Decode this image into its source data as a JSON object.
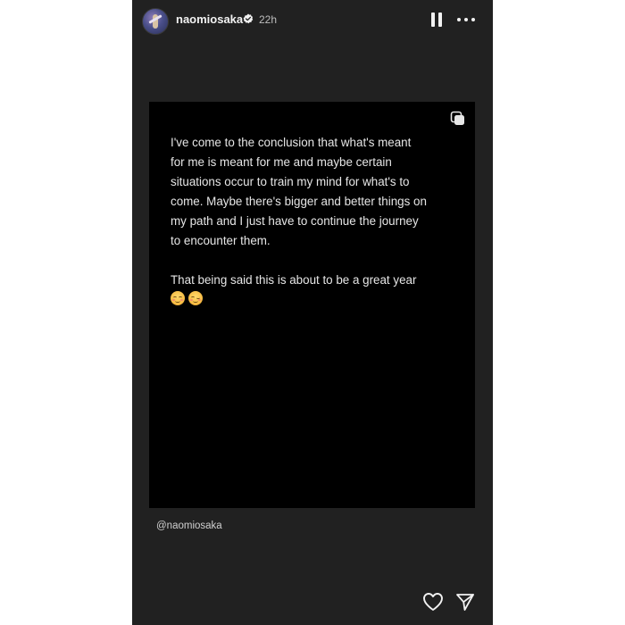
{
  "header": {
    "username": "naomiosaka",
    "verified_icon": "verified-badge-icon",
    "time": "22h",
    "pause_icon": "pause-icon",
    "more_icon": "more-options-icon"
  },
  "card": {
    "copy_icon": "multiple-posts-icon",
    "text": "I've come to the conclusion that what's meant\nfor me is meant for me and maybe certain\nsituations occur to train my mind for what's to\ncome. Maybe there's bigger and better things on\nmy path and I just have to continue the journey\nto encounter them.\n\nThat being said this is about to be a great year",
    "emojis": [
      "relieved-face",
      "winking-face"
    ]
  },
  "mention": "@naomiosaka",
  "footer": {
    "like_icon": "heart-icon",
    "share_icon": "send-icon"
  },
  "colors": {
    "story_background": "#212121",
    "card_background": "#000000",
    "text": "#e6e6e6"
  }
}
